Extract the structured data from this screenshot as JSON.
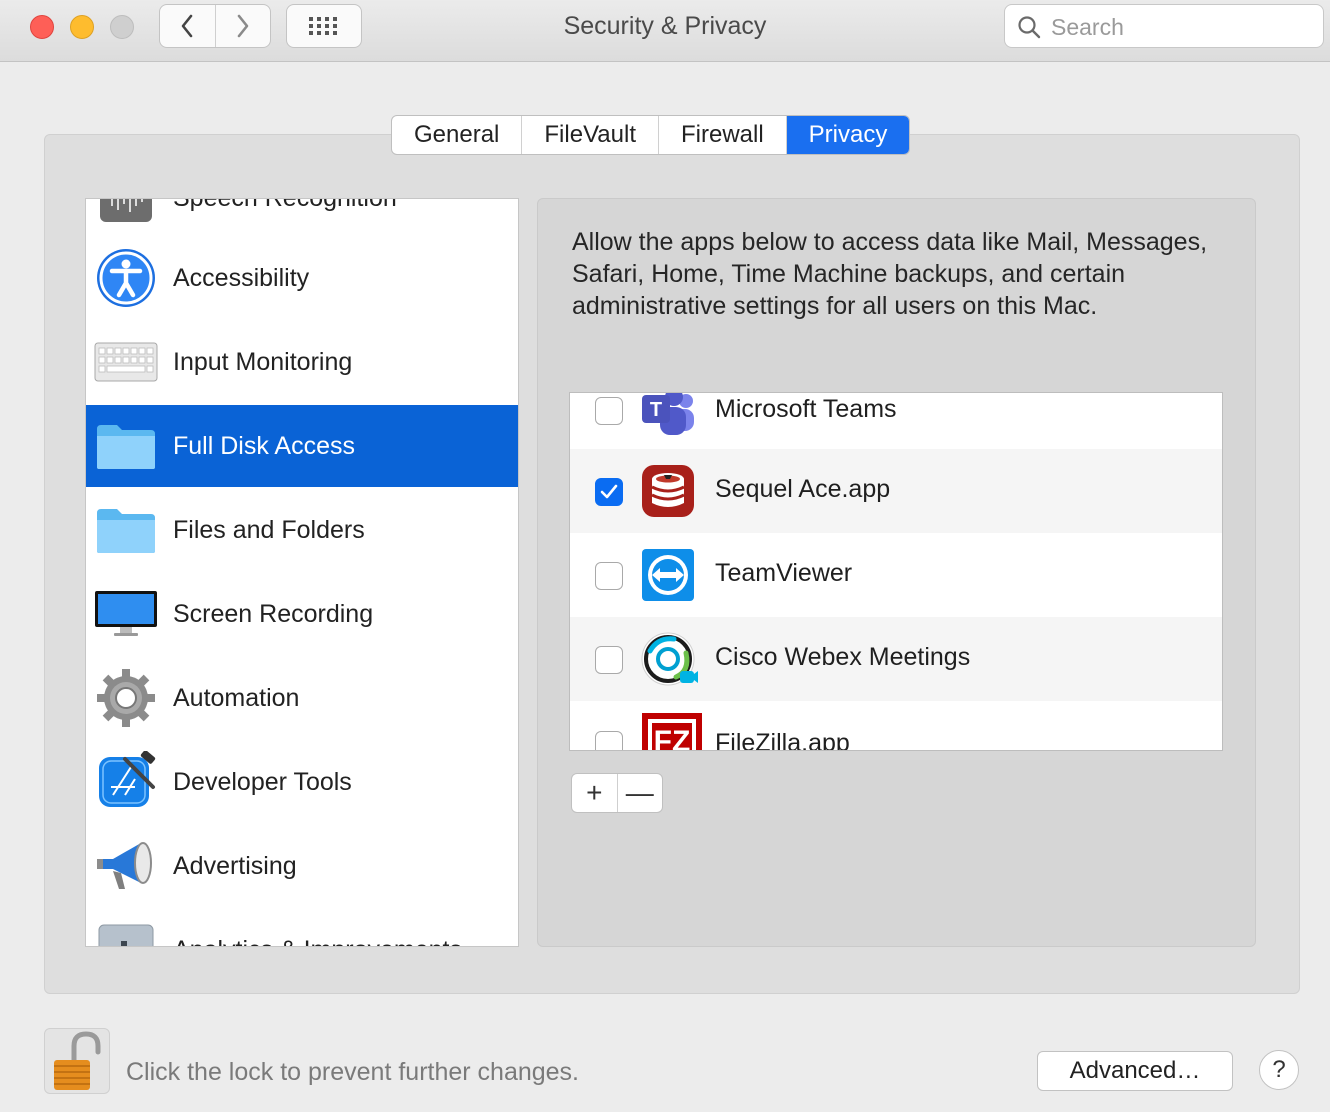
{
  "window": {
    "title": "Security & Privacy"
  },
  "search": {
    "placeholder": "Search"
  },
  "tabs": [
    "General",
    "FileVault",
    "Firewall",
    "Privacy"
  ],
  "sidebar": {
    "items": [
      {
        "label": "Speech Recognition",
        "icon": "waveform-icon"
      },
      {
        "label": "Accessibility",
        "icon": "accessibility-icon"
      },
      {
        "label": "Input Monitoring",
        "icon": "keyboard-icon"
      },
      {
        "label": "Full Disk Access",
        "icon": "folder-icon"
      },
      {
        "label": "Files and Folders",
        "icon": "folder-icon"
      },
      {
        "label": "Screen Recording",
        "icon": "display-icon"
      },
      {
        "label": "Automation",
        "icon": "gear-icon"
      },
      {
        "label": "Developer Tools",
        "icon": "xcode-icon"
      },
      {
        "label": "Advertising",
        "icon": "megaphone-icon"
      },
      {
        "label": "Analytics & Improvements",
        "icon": "bar-chart-icon"
      }
    ],
    "selected": "Full Disk Access"
  },
  "detail": {
    "description": "Allow the apps below to access data like Mail, Messages, Safari, Home, Time Machine backups, and certain administrative settings for all users on this Mac."
  },
  "apps": [
    {
      "name": "Microsoft Teams",
      "checked": false,
      "icon": "teams-icon"
    },
    {
      "name": "Sequel Ace.app",
      "checked": true,
      "icon": "database-icon"
    },
    {
      "name": "TeamViewer",
      "checked": false,
      "icon": "teamviewer-icon"
    },
    {
      "name": "Cisco Webex Meetings",
      "checked": false,
      "icon": "webex-icon"
    },
    {
      "name": "FileZilla.app",
      "checked": false,
      "icon": "filezilla-icon"
    }
  ],
  "list_controls": {
    "add": "+",
    "remove": "—"
  },
  "footer": {
    "lock_text": "Click the lock to prevent further changes.",
    "advanced_label": "Advanced…",
    "help_label": "?"
  },
  "colors": {
    "accent": "#0a63d6",
    "tab_active": "#1a6ff0",
    "checkbox": "#0a6cf2"
  }
}
